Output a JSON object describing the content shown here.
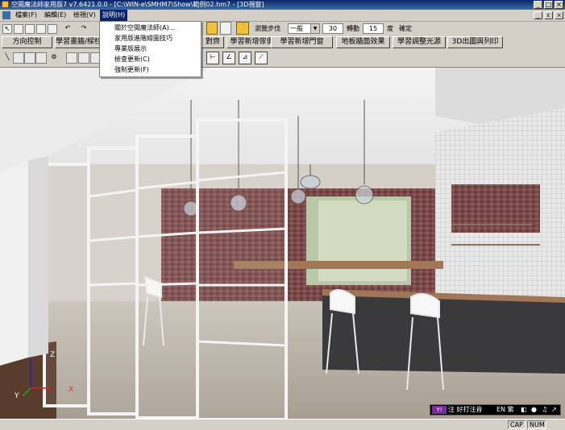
{
  "window": {
    "title": "空間魔法師家用版7  v7.6421.0.0 - [C:\\WIN-e\\SMHM7\\Show\\範例02.hm7 - [3D視窗]",
    "controls": [
      "_",
      "□",
      "×"
    ]
  },
  "menubar": {
    "items": [
      "檔案(F)",
      "編輯(E)",
      "檢視(V)",
      "說明(H)"
    ],
    "active_item": "說明(H)",
    "mdi_controls": [
      "_",
      "ε",
      "×"
    ]
  },
  "help_menu": {
    "items": [
      "關於空間魔法師(A)...",
      "家用版進階繪圖技巧",
      "專業版展示",
      "檢查更新(C)",
      "強制更新(F)"
    ]
  },
  "toolbar1": {
    "browse_step_label": "瀏覽步伐",
    "browse_step_value": "一般",
    "step_value": "30",
    "rotate_label": "轉動",
    "rotate_value": "15",
    "degree_label": "度",
    "confirm_label": "確定"
  },
  "toolbar2": {
    "buttons": [
      "方向控制",
      "學習畫牆/樑柱",
      "對齊",
      "學習新增傢俱",
      "學習新增門窗",
      "地板牆面效果",
      "學習調整光源",
      "3D出圖與列印"
    ]
  },
  "viewport": {
    "axis_labels": {
      "x": "X",
      "y": "Y",
      "z": "Z"
    }
  },
  "ime": {
    "logo": "Y!",
    "text": "注 好打注音",
    "lang": "EN 繁",
    "symbols": [
      "◧",
      "●",
      "♫",
      "↗"
    ]
  },
  "status": {
    "cap": "CAP",
    "num": "NUM"
  }
}
